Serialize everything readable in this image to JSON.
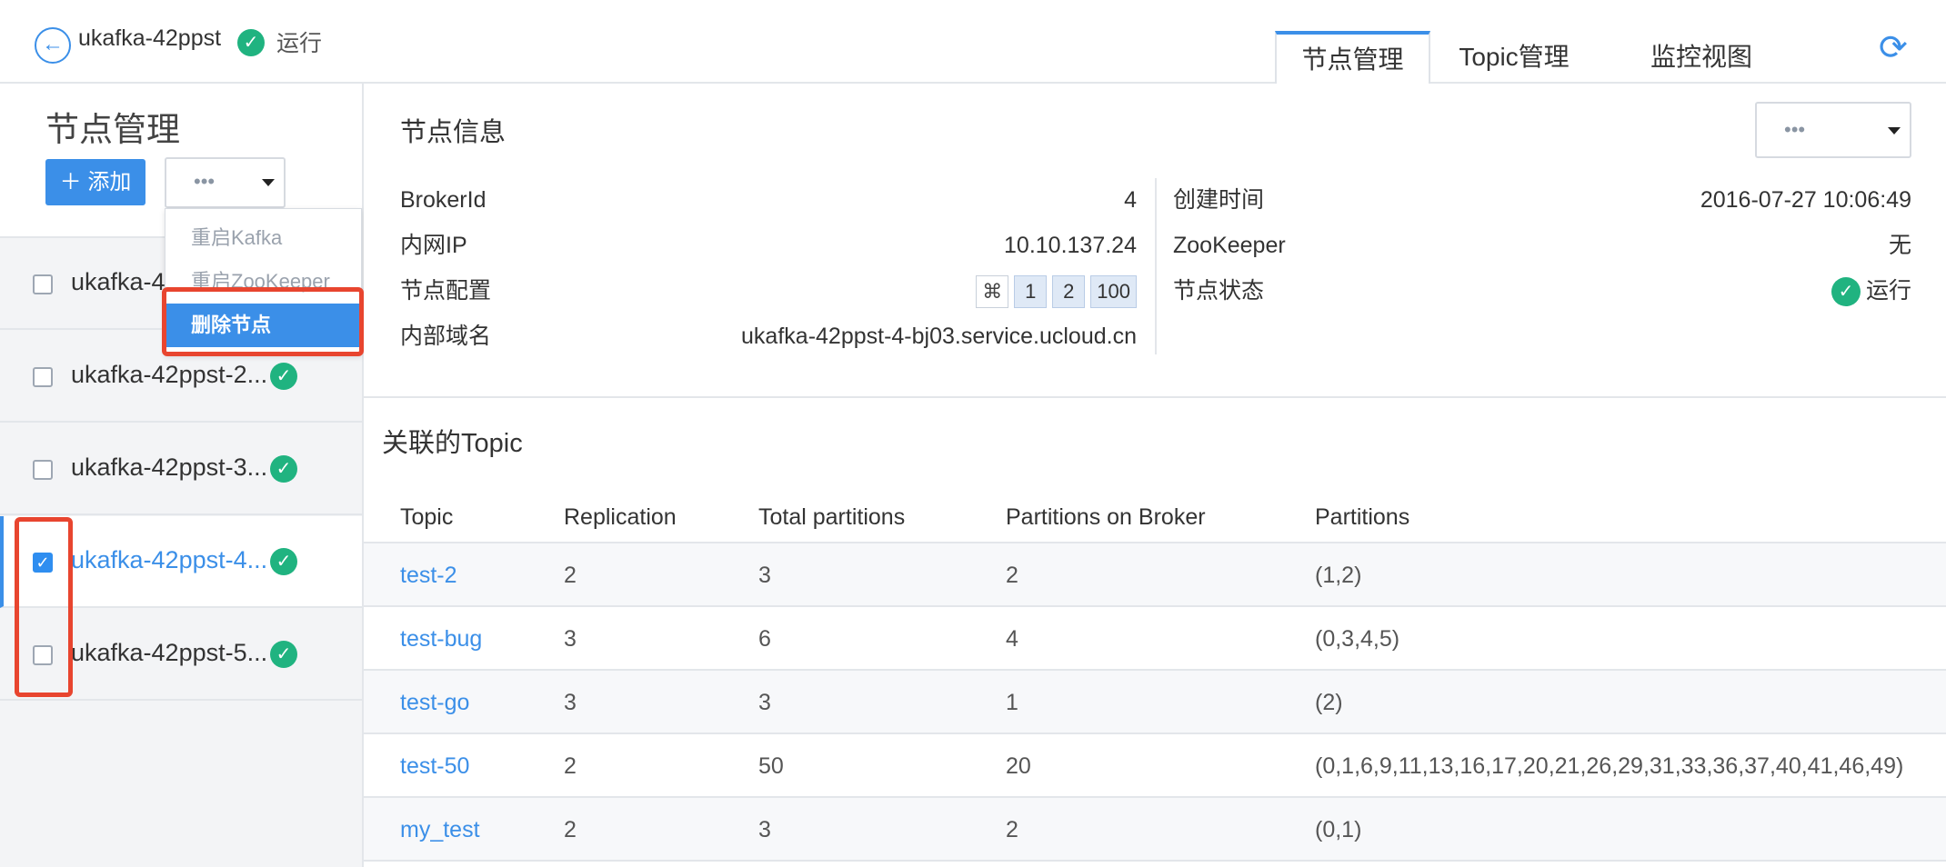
{
  "header": {
    "cluster_name": "ukafka-42ppst",
    "cluster_status": "运行",
    "tabs": [
      {
        "label": "节点管理",
        "active": true
      },
      {
        "label": "Topic管理",
        "active": false
      },
      {
        "label": "监控视图",
        "active": false
      }
    ]
  },
  "sidebar": {
    "title": "节点管理",
    "add_label": "添加",
    "more_label": "•••",
    "nodes": [
      {
        "name": "ukafka-4",
        "checked": false
      },
      {
        "name": "ukafka-42ppst-2...",
        "checked": false
      },
      {
        "name": "ukafka-42ppst-3...",
        "checked": false
      },
      {
        "name": "ukafka-42ppst-4...",
        "checked": true
      },
      {
        "name": "ukafka-42ppst-5...",
        "checked": false
      }
    ],
    "dropdown": [
      {
        "label": "重启Kafka",
        "active": false
      },
      {
        "label": "重启ZooKeeper",
        "active": false
      },
      {
        "label": "删除节点",
        "active": true
      }
    ]
  },
  "info": {
    "title": "节点信息",
    "more_label": "•••",
    "left": [
      {
        "key": "BrokerId",
        "value": "4"
      },
      {
        "key": "内网IP",
        "value": "10.10.137.24"
      },
      {
        "key": "节点配置",
        "value": ""
      },
      {
        "key": "内部域名",
        "value": "ukafka-42ppst-4-bj03.service.ucloud.cn"
      }
    ],
    "config_chips": [
      "1",
      "2",
      "100"
    ],
    "right": [
      {
        "key": "创建时间",
        "value": "2016-07-27 10:06:49"
      },
      {
        "key": "ZooKeeper",
        "value": "无"
      },
      {
        "key": "节点状态",
        "value": "运行"
      }
    ]
  },
  "topics": {
    "title": "关联的Topic",
    "columns": [
      "Topic",
      "Replication",
      "Total partitions",
      "Partitions on Broker",
      "Partitions"
    ],
    "rows": [
      [
        "test-2",
        "2",
        "3",
        "2",
        "(1,2)"
      ],
      [
        "test-bug",
        "3",
        "6",
        "4",
        "(0,3,4,5)"
      ],
      [
        "test-go",
        "3",
        "3",
        "1",
        "(2)"
      ],
      [
        "test-50",
        "2",
        "50",
        "20",
        "(0,1,6,9,11,13,16,17,20,21,26,29,31,33,36,37,40,41,46,49)"
      ],
      [
        "my_test",
        "2",
        "3",
        "2",
        "(0,1)"
      ]
    ]
  },
  "colors": {
    "accent": "#3b8fe8",
    "ok": "#20b380",
    "highlight": "#e8452f"
  },
  "icons": [
    "back-arrow-icon",
    "check-circle-icon",
    "refresh-icon",
    "plus-icon",
    "caret-down-icon",
    "config-icon"
  ]
}
